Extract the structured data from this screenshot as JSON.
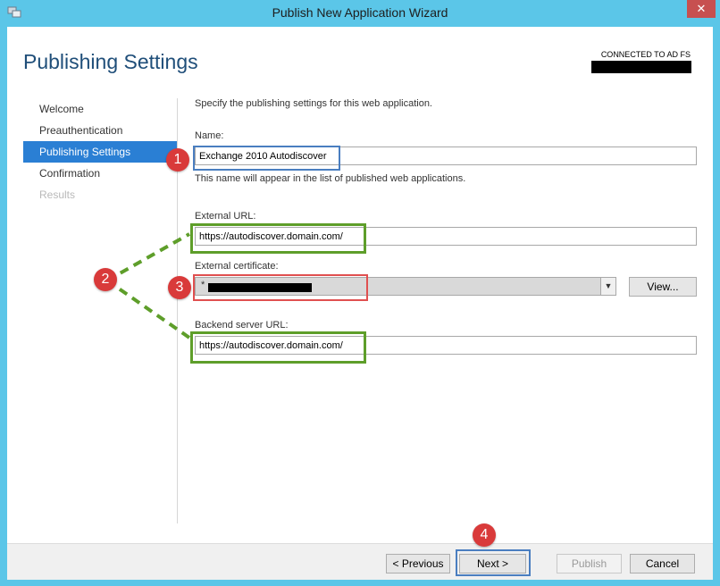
{
  "window": {
    "title": "Publish New Application Wizard",
    "close_label": "✕"
  },
  "header": {
    "page_title": "Publishing Settings",
    "connection_status": "CONNECTED TO AD FS"
  },
  "nav": {
    "items": [
      {
        "label": "Welcome",
        "state": "normal"
      },
      {
        "label": "Preauthentication",
        "state": "normal"
      },
      {
        "label": "Publishing Settings",
        "state": "active"
      },
      {
        "label": "Confirmation",
        "state": "normal"
      },
      {
        "label": "Results",
        "state": "disabled"
      }
    ]
  },
  "form": {
    "intro": "Specify the publishing settings for this web application.",
    "name_label": "Name:",
    "name_value": "Exchange 2010 Autodiscover",
    "name_hint": "This name will appear in the list of published web applications.",
    "external_url_label": "External URL:",
    "external_url_value": "https://autodiscover.domain.com/",
    "external_cert_label": "External certificate:",
    "external_cert_value": "*",
    "view_button": "View...",
    "backend_url_label": "Backend server URL:",
    "backend_url_value": "https://autodiscover.domain.com/"
  },
  "footer": {
    "previous": "< Previous",
    "next": "Next >",
    "publish": "Publish",
    "cancel": "Cancel"
  },
  "annotations": {
    "badge1": "1",
    "badge2": "2",
    "badge3": "3",
    "badge4": "4"
  },
  "colors": {
    "accent": "#2a7fd4",
    "frame": "#5bc6e8",
    "badge": "#d93a3a",
    "highlight_blue": "#4a7ec0",
    "highlight_green": "#5e9e2a",
    "highlight_red": "#e05050"
  }
}
